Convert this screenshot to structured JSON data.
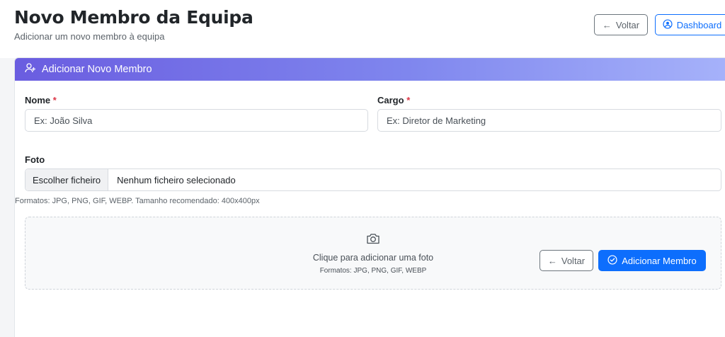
{
  "header": {
    "title": "Novo Membro da Equipa",
    "subtitle": "Adicionar um novo membro à equipa",
    "back_label": "Voltar",
    "dashboard_label": "Dashboard"
  },
  "card": {
    "title": "Adicionar Novo Membro",
    "icon": "user-plus-icon"
  },
  "form": {
    "name": {
      "label": "Nome",
      "required_mark": "*",
      "placeholder": "Ex: João Silva",
      "value": ""
    },
    "role": {
      "label": "Cargo",
      "required_mark": "*",
      "placeholder": "Ex: Diretor de Marketing",
      "value": ""
    },
    "photo": {
      "label": "Foto",
      "choose_label": "Escolher ficheiro",
      "status": "Nenhum ficheiro selecionado",
      "help": "Formatos: JPG, PNG, GIF, WEBP. Tamanho recomendado: 400x400px"
    },
    "dropzone": {
      "icon": "camera-icon",
      "text": "Clique para adicionar uma foto",
      "formats": "Formatos: JPG, PNG, GIF, WEBP"
    }
  },
  "actions": {
    "back_label": "Voltar",
    "submit_label": "Adicionar Membro"
  },
  "colors": {
    "primary": "#0d6efd",
    "header_gradient_start": "#6a5de0",
    "header_gradient_end": "#a6b2fa",
    "required": "#dc3545"
  }
}
